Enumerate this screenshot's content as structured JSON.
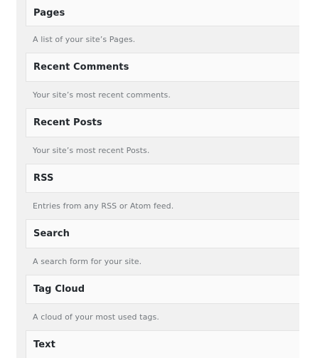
{
  "widgets": [
    {
      "title": "Pages",
      "description": "A list of your site’s Pages."
    },
    {
      "title": "Recent Comments",
      "description": "Your site’s most recent comments."
    },
    {
      "title": "Recent Posts",
      "description": "Your site’s most recent Posts."
    },
    {
      "title": "RSS",
      "description": "Entries from any RSS or Atom feed."
    },
    {
      "title": "Search",
      "description": "A search form for your site."
    },
    {
      "title": "Tag Cloud",
      "description": "A cloud of your most used tags."
    },
    {
      "title": "Text",
      "description": ""
    }
  ]
}
